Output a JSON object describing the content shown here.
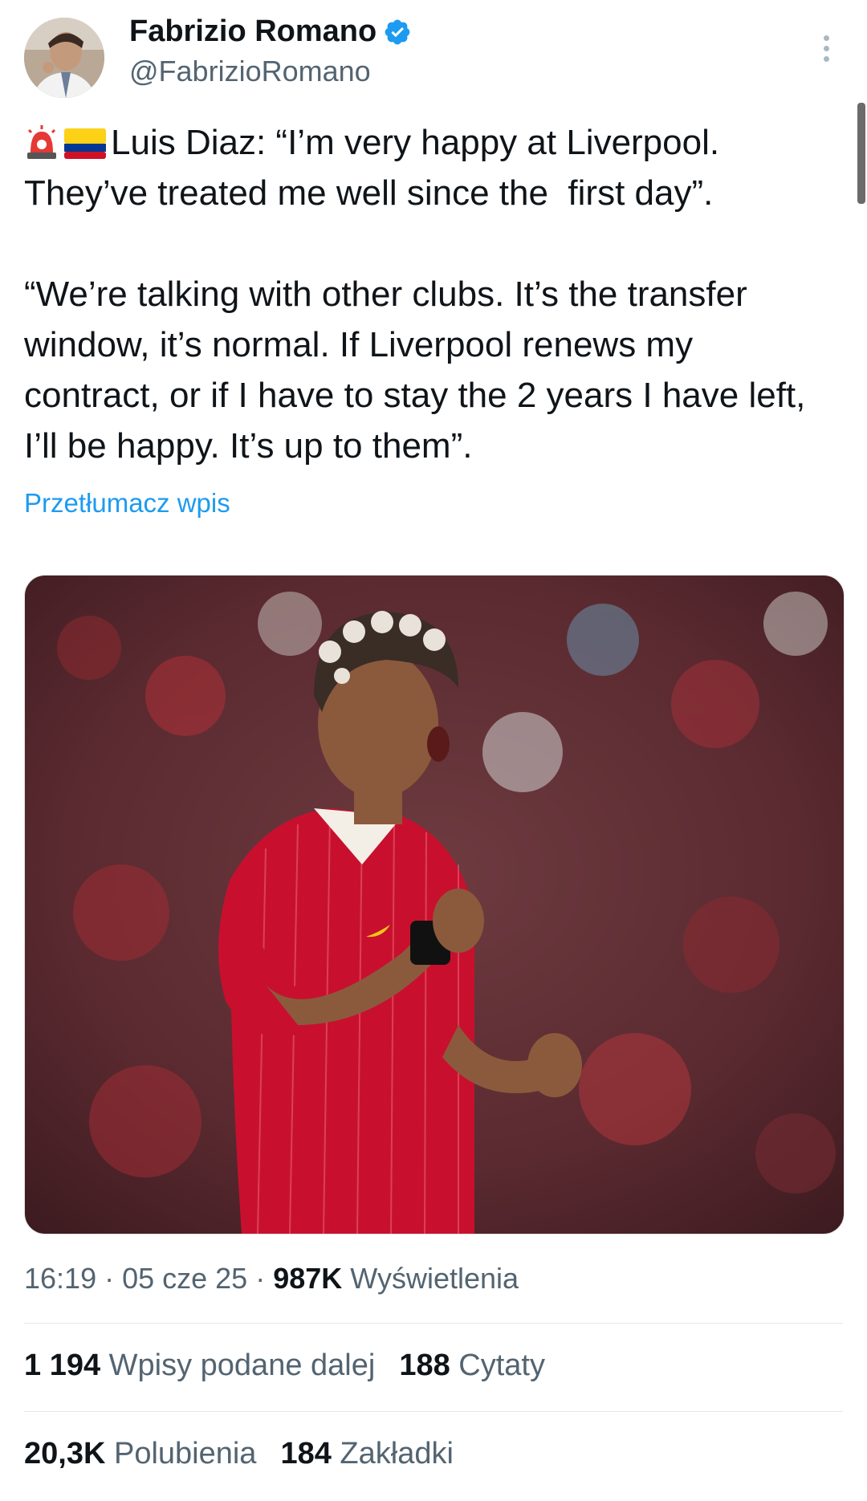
{
  "author": {
    "name": "Fabrizio Romano",
    "handle": "@FabrizioRomano",
    "verified": true,
    "avatar_icon": "profile-photo"
  },
  "post": {
    "paragraph1": "Luis Diaz: “I’m very happy at Liverpool. They’ve treated me well since the  first day”.",
    "paragraph2": "“We’re talking with other clubs. It’s the transfer window, it’s normal. If Liverpool renews my contract, or if I have to stay the 2 years I have left, I’ll be happy. It’s up to them”.",
    "emojis": [
      "rotating-light",
      "flag-colombia"
    ],
    "translate_label": "Przetłumacz wpis",
    "image_icon": "football-player-celebration-photo"
  },
  "meta": {
    "time": "16:19",
    "date": "05 cze 25",
    "views_count": "987K",
    "views_label": "Wyświetlenia"
  },
  "stats": {
    "reposts_count": "1 194",
    "reposts_label": "Wpisy podane dalej",
    "quotes_count": "188",
    "quotes_label": "Cytaty",
    "likes_count": "20,3K",
    "likes_label": "Polubienia",
    "bookmarks_count": "184",
    "bookmarks_label": "Zakładki"
  },
  "colors": {
    "link": "#1d9bf0",
    "secondary_text": "#536471",
    "primary_text": "#0f1419"
  }
}
